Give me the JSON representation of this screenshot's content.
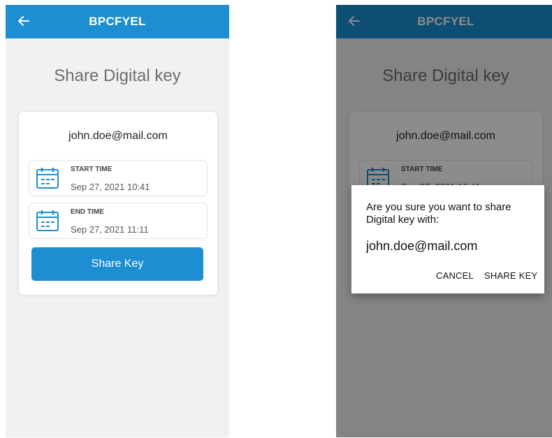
{
  "colors": {
    "primary": "#1c8ed1",
    "background": "#f1f1f1"
  },
  "left_screen": {
    "app_bar": {
      "back_icon": "arrow-left-icon",
      "title": "BPCFYEL"
    },
    "page_title": "Share Digital key",
    "card": {
      "email": "john.doe@mail.com",
      "start": {
        "icon": "calendar-icon",
        "label": "START TIME",
        "value": "Sep 27, 2021 10:41"
      },
      "end": {
        "icon": "calendar-icon",
        "label": "END TIME",
        "value": "Sep 27, 2021 11:11"
      },
      "share_button": "Share Key"
    }
  },
  "right_screen": {
    "app_bar": {
      "back_icon": "arrow-left-icon",
      "title": "BPCFYEL"
    },
    "page_title": "Share Digital key",
    "card": {
      "email": "john.doe@mail.com",
      "start": {
        "icon": "calendar-icon",
        "label": "START TIME",
        "value": "Sep 27, 2021 10:41"
      }
    },
    "dialog": {
      "message": "Are you sure you want to share Digital key with:",
      "email": "john.doe@mail.com",
      "cancel": "CANCEL",
      "confirm": "SHARE KEY"
    }
  }
}
